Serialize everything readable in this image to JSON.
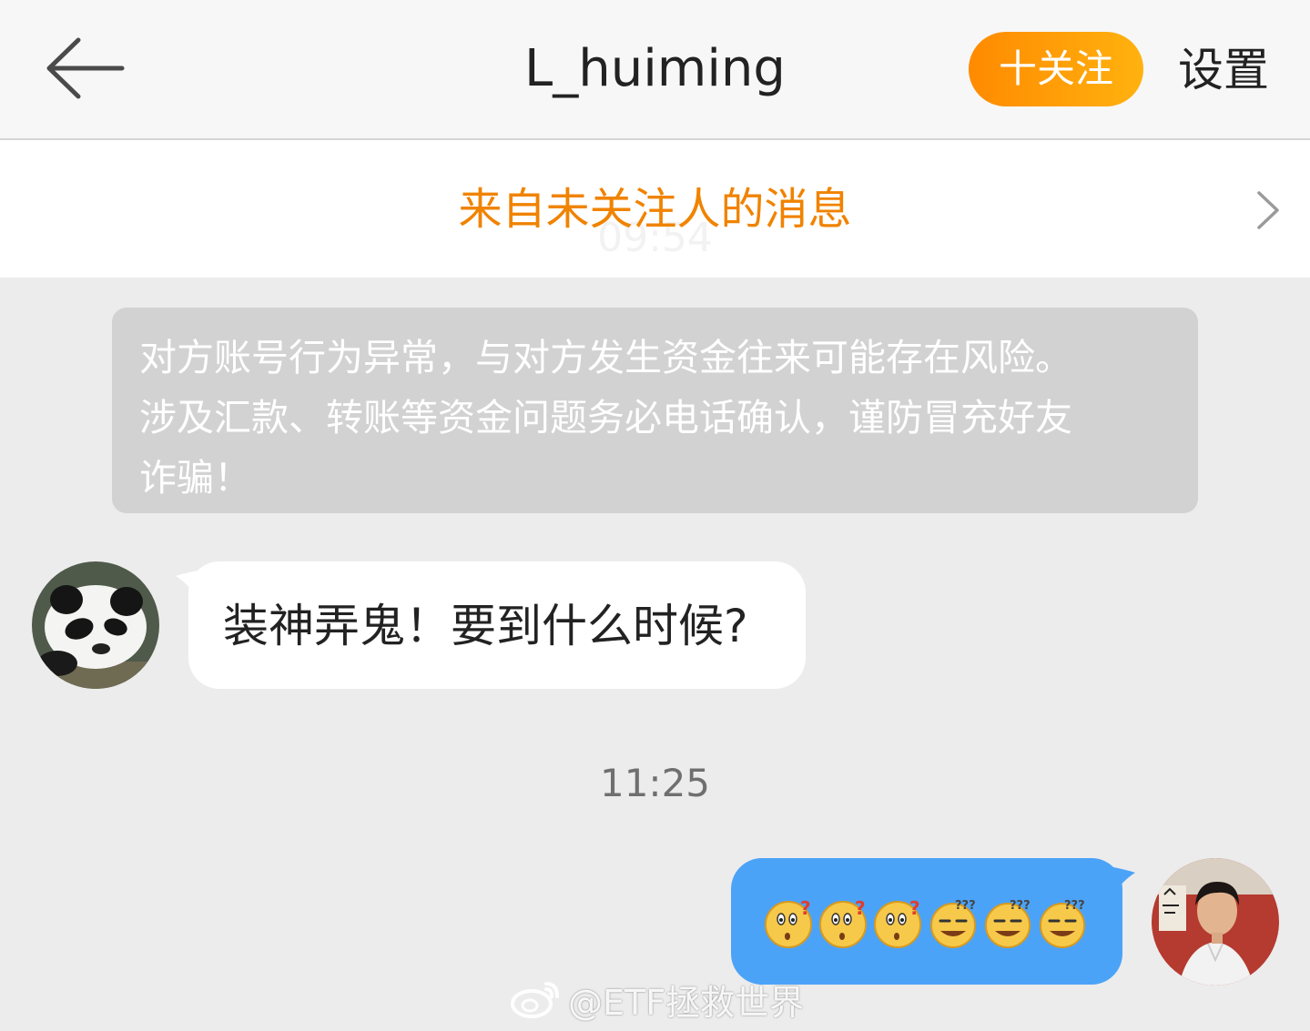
{
  "header": {
    "back_icon": "back-arrow-icon",
    "title": "L_huiming",
    "follow_label": "十关注",
    "settings_label": "设置"
  },
  "notice": {
    "label": "来自未关注人的消息",
    "ghost_time": "09:54",
    "chevron_icon": "chevron-right-icon"
  },
  "warning": {
    "lines": [
      "对方账号行为异常，与对方发生资金往来可能存在风险。",
      "涉及汇款、转账等资金问题务必电话确认，谨防冒充好友",
      "诈骗！"
    ]
  },
  "messages": {
    "incoming": {
      "text": "装神弄鬼！要到什么时候?",
      "avatar": "panda-avatar"
    },
    "timestamp": "11:25",
    "outgoing": {
      "emojis": [
        "confused-emoji",
        "confused-emoji",
        "confused-emoji",
        "dizzy-grin-emoji",
        "dizzy-grin-emoji",
        "dizzy-grin-emoji"
      ],
      "avatar": "man-photo-avatar"
    }
  },
  "watermark": {
    "text": "@ETF拯救世界",
    "icon": "weibo-logo-icon"
  },
  "colors": {
    "accent": "#f08300",
    "follow_bg": "#ffa000",
    "outgoing_bubble": "#4ba3f8",
    "warning_bg": "#d2d2d2"
  }
}
